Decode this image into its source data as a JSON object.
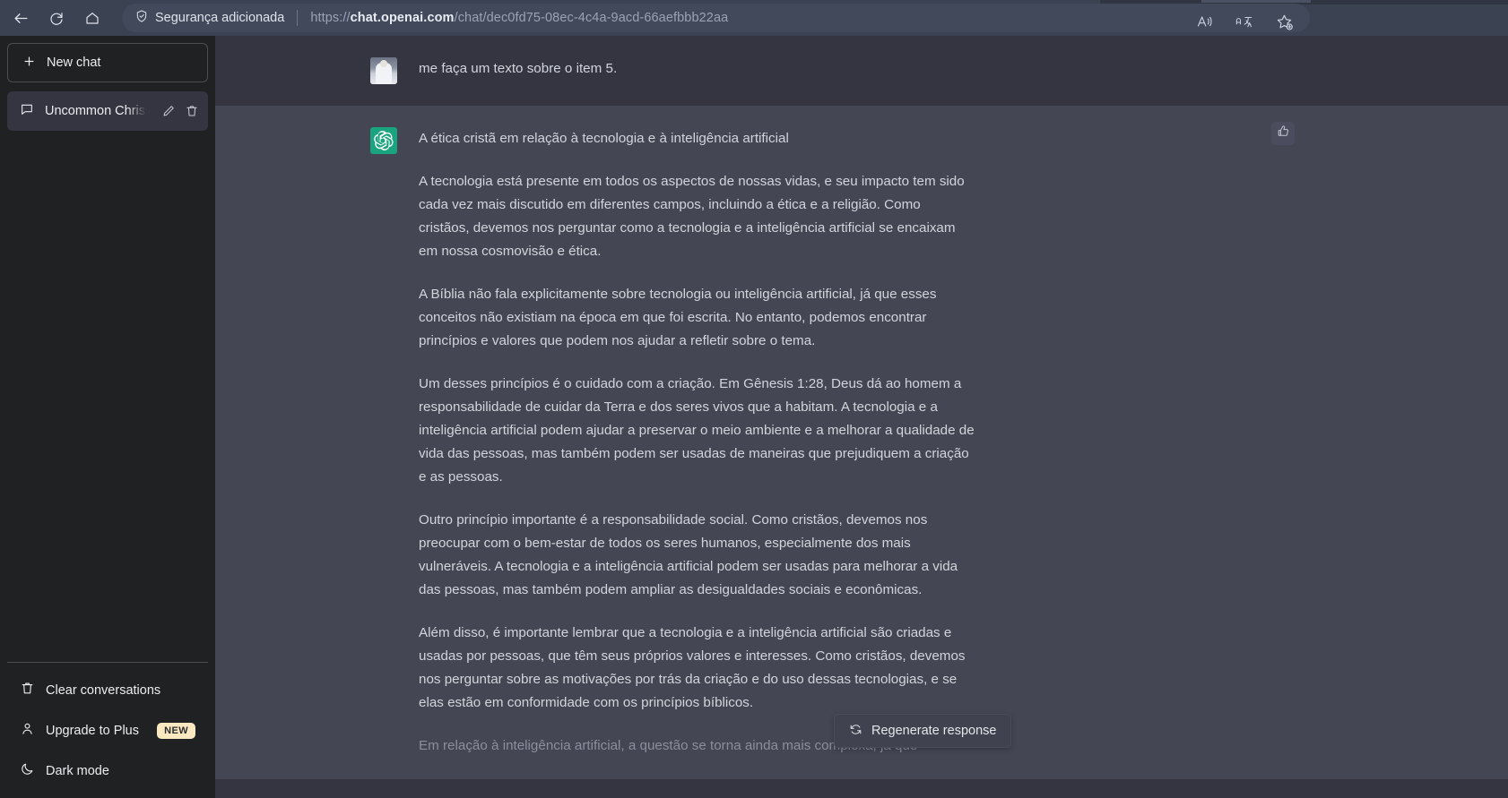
{
  "browser": {
    "back_icon": "back-arrow-icon",
    "reload_icon": "reload-icon",
    "home_icon": "home-icon",
    "security_label": "Segurança adicionada",
    "url_scheme": "https://",
    "url_host": "chat.openai.com",
    "url_path": "/chat/dec0fd75-08ec-4c4a-9acd-66aefbbb22aa",
    "read_aloud_icon": "read-aloud-icon",
    "translate_icon": "translate-icon",
    "add_favorite_icon": "add-to-favorites-icon"
  },
  "sidebar": {
    "new_chat_label": "New chat",
    "new_chat_icon": "plus-icon",
    "chats": [
      {
        "label": "Uncommon Christian Bl",
        "icon": "chat-bubble-icon",
        "edit_icon": "pencil-icon",
        "delete_icon": "trash-icon"
      }
    ],
    "footer": [
      {
        "label": "Clear conversations",
        "icon": "trash-icon",
        "badge": ""
      },
      {
        "label": "Upgrade to Plus",
        "icon": "person-icon",
        "badge": "NEW"
      },
      {
        "label": "Dark mode",
        "icon": "moon-icon",
        "badge": ""
      }
    ]
  },
  "conversation": {
    "user_message": {
      "avatar": "user-photo-avatar",
      "text": "me faça um texto sobre o item 5."
    },
    "assistant_message": {
      "avatar": "chatgpt-logo-avatar",
      "thumbs_up_icon": "thumbs-up-icon",
      "paragraphs": [
        "A ética cristã em relação à tecnologia e à inteligência artificial",
        "A tecnologia está presente em todos os aspectos de nossas vidas, e seu impacto tem sido cada vez mais discutido em diferentes campos, incluindo a ética e a religião. Como cristãos, devemos nos perguntar como a tecnologia e a inteligência artificial se encaixam em nossa cosmovisão e ética.",
        "A Bíblia não fala explicitamente sobre tecnologia ou inteligência artificial, já que esses conceitos não existiam na época em que foi escrita. No entanto, podemos encontrar princípios e valores que podem nos ajudar a refletir sobre o tema.",
        "Um desses princípios é o cuidado com a criação. Em Gênesis 1:28, Deus dá ao homem a responsabilidade de cuidar da Terra e dos seres vivos que a habitam. A tecnologia e a inteligência artificial podem ajudar a preservar o meio ambiente e a melhorar a qualidade de vida das pessoas, mas também podem ser usadas de maneiras que prejudiquem a criação e as pessoas.",
        "Outro princípio importante é a responsabilidade social. Como cristãos, devemos nos preocupar com o bem-estar de todos os seres humanos, especialmente dos mais vulneráveis. A tecnologia e a inteligência artificial podem ser usadas para melhorar a vida das pessoas, mas também podem ampliar as desigualdades sociais e econômicas.",
        "Além disso, é importante lembrar que a tecnologia e a inteligência artificial são criadas e usadas por pessoas, que têm seus próprios valores e interesses. Como cristãos, devemos nos perguntar sobre as motivações por trás da criação e do uso dessas tecnologias, e se elas estão em conformidade com os princípios bíblicos.",
        "Em relação à inteligência artificial, a questão se torna ainda mais complexa, já que"
      ]
    },
    "regenerate_label": "Regenerate response",
    "regenerate_icon": "refresh-icon"
  },
  "colors": {
    "chrome": "#3b4252",
    "sidebar": "#202123",
    "user_bubble": "#343541",
    "assistant_bubble": "#444654",
    "accent_green": "#19a37f",
    "badge_yellow": "#f9e8c0"
  }
}
